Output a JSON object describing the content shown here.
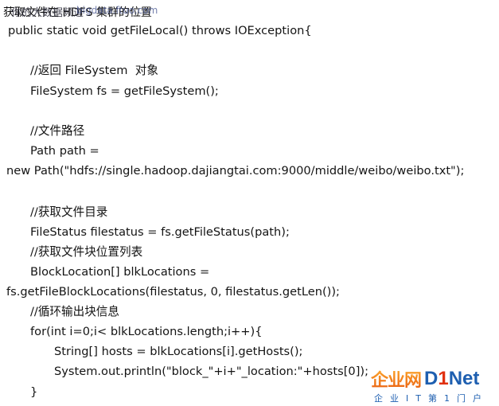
{
  "header": {
    "title_layer_a": "获取文件在 HDFS 集群的位置",
    "title_layer_b": "你的大数据频道",
    "title_layer_c": "bigdata.ftuo.com"
  },
  "code_lines": [
    "public static void getFileLocal() throws IOException{",
    "",
    "//返回 FileSystem  对象",
    "FileSystem fs = getFileSystem();",
    "",
    "//文件路径",
    "Path path =",
    "new Path(\"hdfs://single.hadoop.dajiangtai.com:9000/middle/weibo/weibo.txt\");",
    "",
    "//获取文件目录",
    "FileStatus filestatus = fs.getFileStatus(path);",
    "//获取文件块位置列表",
    "BlockLocation[] blkLocations =",
    "fs.getFileBlockLocations(filestatus, 0, filestatus.getLen());",
    "//循环输出块信息",
    "for(int i=0;i< blkLocations.length;i++){",
    "String[] hosts = blkLocations[i].getHosts();",
    "System.out.println(\"block_\"+i+\"_location:\"+hosts[0]);",
    "}"
  ],
  "watermark": {
    "name_cn": "企业网",
    "name_en_a": "D",
    "name_en_one": "1",
    "name_en_b": "Net",
    "slogan": "企业IT第1门户",
    "colors": {
      "orange": "#f07818",
      "blue": "#1e5fb0",
      "red": "#e03010"
    }
  }
}
